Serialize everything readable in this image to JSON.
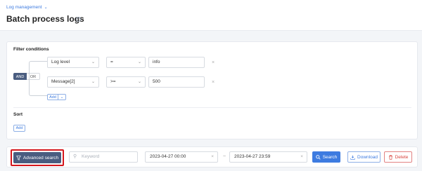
{
  "breadcrumb": {
    "label": "Log management",
    "chevron": "⌄"
  },
  "page": {
    "title": "Batch process logs",
    "help_icon": "?"
  },
  "filter": {
    "section_label": "Filter conditions",
    "logic": {
      "and_label": "AND",
      "or_label": "OR",
      "active": "AND"
    },
    "conditions": [
      {
        "field": "Log level",
        "operator": "=",
        "value": "info"
      },
      {
        "field": "Message[2]",
        "operator": ">=",
        "value": "500"
      }
    ],
    "add_label": "Add",
    "add_dropdown": "⌄",
    "remove_symbol": "×"
  },
  "sort": {
    "section_label": "Sort",
    "add_label": "Add"
  },
  "toolbar": {
    "advanced_search_label": "Advanced search",
    "keyword_placeholder": "Keyword",
    "date_start": "2023-04-27 00:00",
    "date_end": "2023-04-27 23:59",
    "range_separator": "~",
    "clear_symbol": "×",
    "search_label": "Search",
    "download_label": "Download",
    "delete_label": "Delete"
  },
  "colors": {
    "primary": "#3d7be0",
    "dark_button": "#4a5d80",
    "danger": "#d9453f",
    "highlight_border": "#d4161c"
  },
  "icons": [
    "chevron-down-icon",
    "help-icon",
    "remove-icon",
    "filter-icon",
    "search-icon",
    "clear-icon",
    "download-icon",
    "trash-icon"
  ]
}
